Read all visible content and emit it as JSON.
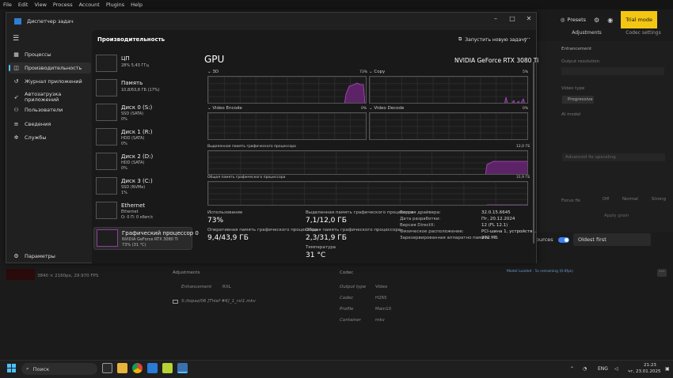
{
  "menubar": {
    "items": [
      "File",
      "Edit",
      "View",
      "Process",
      "Account",
      "Plugins",
      "Help"
    ]
  },
  "topaz": {
    "presets_label": "Presets",
    "trial_label": "Trial mode",
    "right_tabs": [
      "Adjustments",
      "Codec settings"
    ],
    "enhancement_label": "Enhancement",
    "output_resolution_label": "Output resolution",
    "video_type_label": "Video type",
    "progressive_label": "Progressive",
    "ai_model_label": "AI model",
    "upscaling_label": "Advanced 4x upscaling",
    "focus_fix_label": "Focus fix",
    "focus_options": [
      "Off",
      "Normal",
      "Strong"
    ],
    "apply_grain_label": "Apply grain",
    "sources_label": "ources",
    "sort_label": "Oldest first",
    "job": {
      "info": "3840 × 2160px, 29.970 FPS",
      "progress_text": "Model Loaded · 5s remaining (0.0fps)"
    },
    "adjustments_header": "Adjustments",
    "codec_header": "Codec",
    "enhancement_row": {
      "label": "Enhancement",
      "value": "RXL"
    },
    "file_path": "S:/topaz/06 [Thief #6]_1_rxl1.mkv",
    "codec_rows": [
      {
        "label": "Output type",
        "value": "Video"
      },
      {
        "label": "Codec",
        "value": "H265"
      },
      {
        "label": "Profile",
        "value": "Main10"
      },
      {
        "label": "Container",
        "value": "mkv"
      }
    ]
  },
  "taskmgr": {
    "window_title": "Диспетчер задач",
    "nav": [
      {
        "label": "Процессы",
        "icon": "grid-icon"
      },
      {
        "label": "Производительность",
        "icon": "chart-icon",
        "active": true
      },
      {
        "label": "Журнал приложений",
        "icon": "history-icon"
      },
      {
        "label": "Автозагрузка приложений",
        "icon": "rocket-icon"
      },
      {
        "label": "Пользователи",
        "icon": "users-icon"
      },
      {
        "label": "Сведения",
        "icon": "list-icon"
      },
      {
        "label": "Службы",
        "icon": "services-icon"
      }
    ],
    "settings_label": "Параметры",
    "section_title": "Производительность",
    "new_task_label": "Запустить новую задачу",
    "perf_items": [
      {
        "name": "ЦП",
        "sub1": "28%  5,43 ГГц",
        "sub2": ""
      },
      {
        "name": "Память",
        "sub1": "10,8/63,8 ГБ (17%)",
        "sub2": ""
      },
      {
        "name": "Диск 0 (S:)",
        "sub1": "SSD (SATA)",
        "sub2": "0%"
      },
      {
        "name": "Диск 1 (R:)",
        "sub1": "HDD (SATA)",
        "sub2": "0%"
      },
      {
        "name": "Диск 2 (D:)",
        "sub1": "HDD (SATA)",
        "sub2": "0%"
      },
      {
        "name": "Диск 3 (C:)",
        "sub1": "SSD (NVMe)",
        "sub2": "1%"
      },
      {
        "name": "Ethernet",
        "sub1": "Ethernet",
        "sub2": "О: 0 П: 0 кбит/с"
      },
      {
        "name": "Графический процессор 0",
        "sub1": "NVIDIA GeForce RTX 3080 Ti",
        "sub2": "73% (31 °C)",
        "active": true
      }
    ],
    "gpu": {
      "title": "GPU",
      "model": "NVIDIA GeForce RTX 3080 Ti",
      "graphs": [
        {
          "label": "3D",
          "pct": "73%"
        },
        {
          "label": "Copy",
          "pct": "5%"
        },
        {
          "label": "Video Encode",
          "pct": "0%"
        },
        {
          "label": "Video Decode",
          "pct": "0%"
        }
      ],
      "dedicated_mem_label": "Выделенная память графического процессора",
      "dedicated_mem_max": "12,0 ГБ",
      "shared_mem_label": "Общая память графического процессора",
      "shared_mem_max": "31,9 ГБ",
      "stats": {
        "usage_label": "Использование",
        "usage_value": "73%",
        "ram_label": "Оперативная память графического процессора",
        "ram_value": "9,4/43,9 ГБ",
        "ded_label": "Выделенная память графического процессора",
        "ded_value": "7,1/12,0 ГБ",
        "shared_label": "Общая память графического процессора",
        "shared_value": "2,3/31,9 ГБ",
        "temp_label": "Температура",
        "temp_value": "31 °C"
      },
      "info": [
        {
          "k": "Версия драйвера:",
          "v": "32.0.15.6645"
        },
        {
          "k": "Дата разработки:",
          "v": "Пт, 20.12.2024"
        },
        {
          "k": "Версия DirectX:",
          "v": "12 (FL 12.1)"
        },
        {
          "k": "Физическое расположение:",
          "v": "PCI-шина 1, устройств..."
        },
        {
          "k": "Зарезервированная аппаратно память:",
          "v": "202 МБ"
        }
      ]
    }
  },
  "taskbar": {
    "search_placeholder": "Поиск",
    "lang": "ENG",
    "time": "21:23",
    "date": "чт, 23.01.2025"
  },
  "colors": {
    "accent": "#f3c613",
    "gpu_graph": "#9b3fae",
    "toggle": "#3b82f6"
  }
}
